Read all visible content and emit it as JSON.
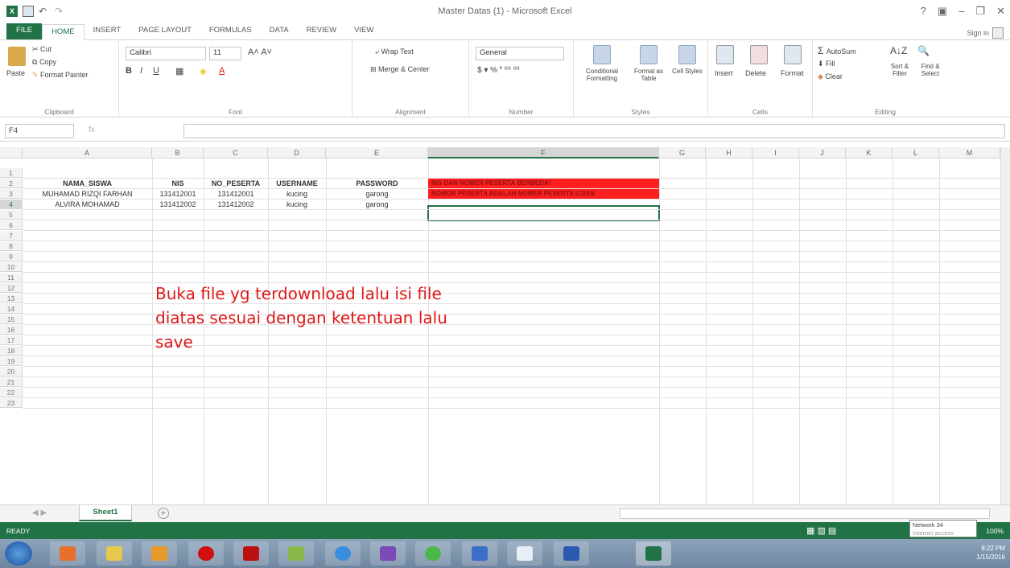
{
  "window": {
    "title": "Master Datas (1) - Microsoft Excel",
    "sign_in": "Sign in"
  },
  "tabs": [
    "FILE",
    "HOME",
    "INSERT",
    "PAGE LAYOUT",
    "FORMULAS",
    "DATA",
    "REVIEW",
    "VIEW"
  ],
  "ribbon": {
    "clipboard": {
      "paste": "Paste",
      "cut": "Cut",
      "copy": "Copy",
      "format_painter": "Format Painter",
      "label": "Clipboard"
    },
    "font": {
      "name": "Calibri",
      "size": "11",
      "label": "Font"
    },
    "alignment": {
      "wrap": "Wrap Text",
      "merge": "Merge & Center",
      "label": "Alignment"
    },
    "number": {
      "format": "General",
      "label": "Number"
    },
    "styles": {
      "cond": "Conditional Formatting",
      "table": "Format as Table",
      "cell": "Cell Styles",
      "label": "Styles"
    },
    "cells": {
      "insert": "Insert",
      "delete": "Delete",
      "format": "Format",
      "label": "Cells"
    },
    "editing": {
      "autosum": "AutoSum",
      "fill": "Fill",
      "clear": "Clear",
      "sort": "Sort & Filter",
      "find": "Find & Select",
      "label": "Editing"
    }
  },
  "formula_bar": {
    "name_box": "F4",
    "fx": "fx"
  },
  "columns": [
    "A",
    "B",
    "C",
    "D",
    "E",
    "F",
    "G",
    "H",
    "I",
    "J",
    "K",
    "L",
    "M"
  ],
  "rows": [
    "1",
    "2",
    "3",
    "4",
    "5",
    "6",
    "7",
    "8",
    "9",
    "10",
    "11",
    "12",
    "13",
    "14",
    "15",
    "16",
    "17",
    "18",
    "19",
    "20",
    "21",
    "22",
    "23"
  ],
  "sheet": {
    "headers": [
      "NAMA_SISWA",
      "NIS",
      "NO_PESERTA",
      "USERNAME",
      "PASSWORD"
    ],
    "data": [
      [
        "MUHAMAD RIZQI FARHAN",
        "131412001",
        "131412001",
        "kucing",
        "garong"
      ],
      [
        "ALVIRA MOHAMAD",
        "131412002",
        "131412002",
        "kucing",
        "garong"
      ]
    ],
    "notes": [
      "NIS DAN NOMER PESERTA BERBEDA!",
      "NOMOR PESERTA ADALAH NOMER PESERTA UJIAN"
    ]
  },
  "annotation": [
    "Buka file yg terdownload lalu isi file",
    "diatas sesuai dengan ketentuan lalu",
    "save"
  ],
  "sheet_tab": "Sheet1",
  "status": {
    "ready": "READY",
    "zoom": "100%",
    "network": "Network 34",
    "network_sub": "Internet access"
  },
  "clock": {
    "time": "8:22 PM",
    "date": "1/15/2016"
  }
}
